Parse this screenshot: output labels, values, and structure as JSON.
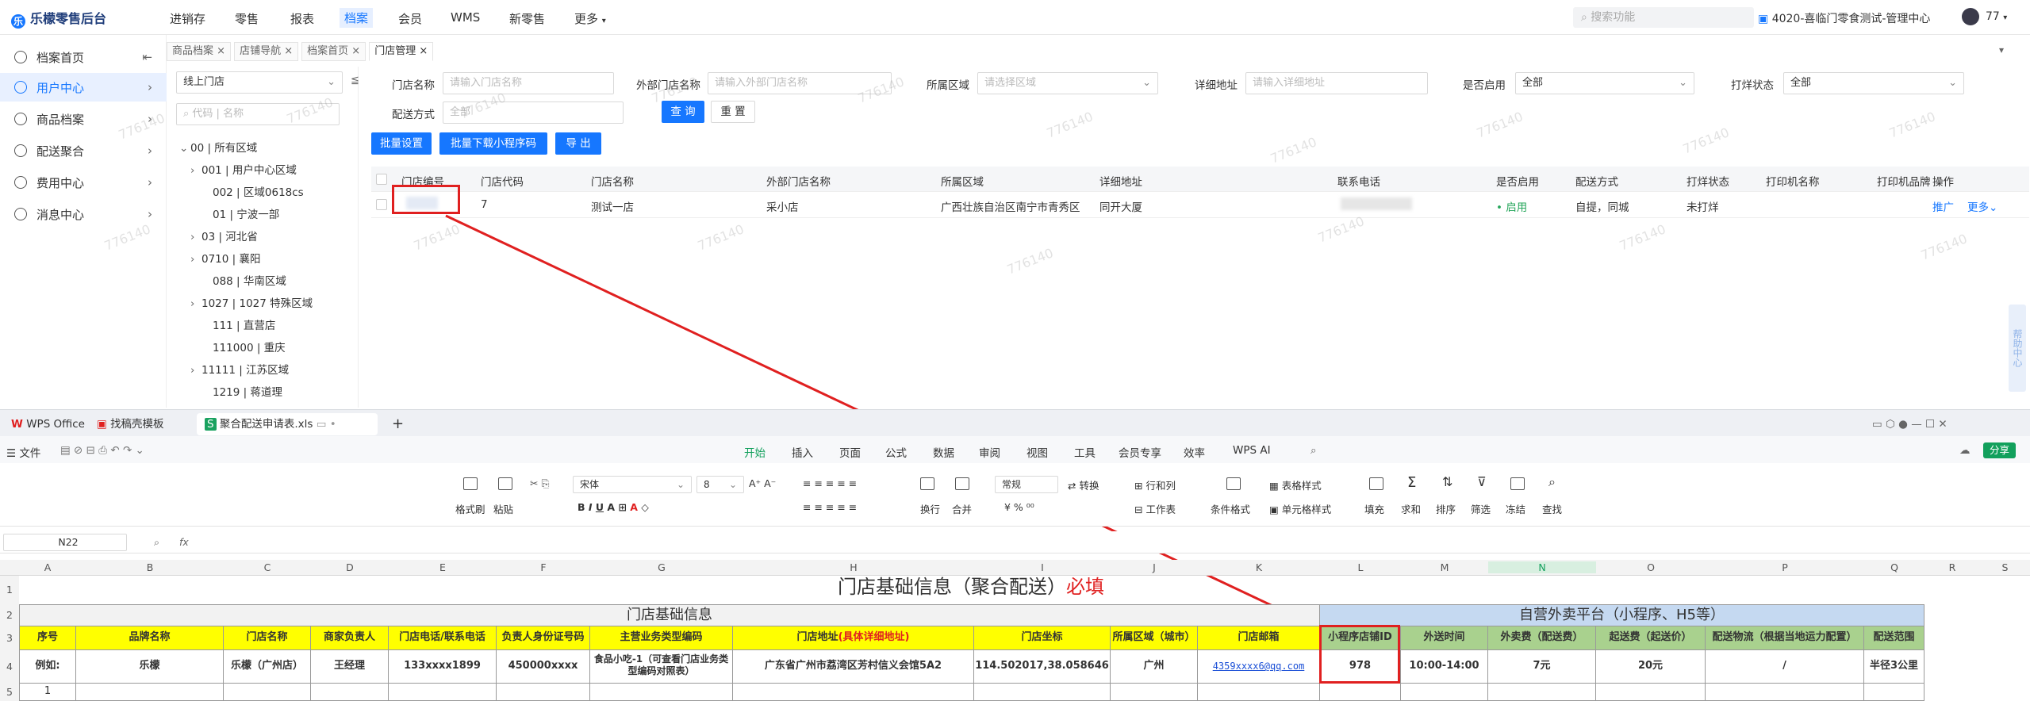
{
  "app": {
    "brand": "乐檬零售后台",
    "nav": [
      "进销存",
      "零售",
      "报表",
      "档案",
      "会员",
      "WMS",
      "新零售",
      "更多"
    ],
    "active_nav": "档案",
    "search_placeholder": "搜索功能",
    "store": "4020-喜临门零食测试-管理中心",
    "user": "77"
  },
  "sidebar": {
    "items": [
      {
        "label": "档案首页",
        "icon": "home-icon"
      },
      {
        "label": "用户中心",
        "icon": "user-icon"
      },
      {
        "label": "商品档案",
        "icon": "box-icon"
      },
      {
        "label": "配送聚合",
        "icon": "truck-icon"
      },
      {
        "label": "费用中心",
        "icon": "money-icon"
      },
      {
        "label": "消息中心",
        "icon": "bell-icon"
      }
    ],
    "active": "用户中心"
  },
  "tabs": [
    {
      "label": "商品档案"
    },
    {
      "label": "店铺导航"
    },
    {
      "label": "档案首页"
    },
    {
      "label": "门店管理"
    }
  ],
  "tree": {
    "store_type": "线上门店",
    "search_placeholder": "代码 | 名称",
    "nodes": [
      {
        "label": "00 | 所有区域",
        "expand": "open"
      },
      {
        "label": "001 | 用户中心区域",
        "expand": "closed"
      },
      {
        "label": "002 | 区域0618cs",
        "expand": "none"
      },
      {
        "label": "01 | 宁波一部",
        "expand": "none"
      },
      {
        "label": "03 | 河北省",
        "expand": "closed"
      },
      {
        "label": "0710 | 襄阳",
        "expand": "closed"
      },
      {
        "label": "088 | 华南区域",
        "expand": "none"
      },
      {
        "label": "1027 | 1027 特殊区域",
        "expand": "closed"
      },
      {
        "label": "111 | 直营店",
        "expand": "none"
      },
      {
        "label": "111000 | 重庆",
        "expand": "none"
      },
      {
        "label": "11111 | 江苏区域",
        "expand": "closed"
      },
      {
        "label": "1219 | 蒋道理",
        "expand": "none"
      }
    ]
  },
  "filters": {
    "store_name": {
      "label": "门店名称",
      "placeholder": "请输入门店名称"
    },
    "ext_name": {
      "label": "外部门店名称",
      "placeholder": "请输入外部门店名称"
    },
    "region": {
      "label": "所属区域",
      "placeholder": "请选择区域"
    },
    "address": {
      "label": "详细地址",
      "placeholder": "请输入详细地址"
    },
    "enabled": {
      "label": "是否启用",
      "value": "全部"
    },
    "print": {
      "label": "打烊状态",
      "value": "全部"
    },
    "delivery": {
      "label": "配送方式",
      "value": "全部"
    },
    "query": "查 询",
    "reset": "重 置"
  },
  "actions": {
    "batch_set": "批量设置",
    "batch_download": "批量下载小程序码",
    "export": "导 出"
  },
  "table": {
    "headers": [
      "门店编号",
      "门店代码",
      "门店名称",
      "外部门店名称",
      "所属区域",
      "详细地址",
      "联系电话",
      "是否启用",
      "配送方式",
      "打烊状态",
      "打印机名称",
      "打印机品牌",
      "操作"
    ],
    "row": {
      "code": "7",
      "name": "测试一店",
      "ext_name": "采小店",
      "region": "广西壮族自治区南宁市青秀区",
      "address": "同开大厦",
      "enabled": "启用",
      "delivery": "自提，同城",
      "print_status": "未打烊",
      "op1": "推广",
      "op2": "更多"
    }
  },
  "watermark": "776140",
  "help_tab": "帮助中心",
  "wps": {
    "tabs": [
      {
        "label": "WPS Office"
      },
      {
        "label": "找稿壳模板"
      },
      {
        "label": "聚合配送申请表.xls"
      }
    ],
    "file_menu": "文件",
    "menus": [
      "开始",
      "插入",
      "页面",
      "公式",
      "数据",
      "审阅",
      "视图",
      "工具",
      "会员专享",
      "效率",
      "WPS AI"
    ],
    "active_menu": "开始",
    "share": "分享",
    "ribbon": {
      "format_painter": "格式刷",
      "paste": "粘贴",
      "font": "宋体",
      "size": "8",
      "wrap": "换行",
      "merge": "合并",
      "general": "常规",
      "convert": "转换",
      "rowcol": "行和列",
      "sheet": "工作表",
      "cond": "条件格式",
      "tablestyle": "表格样式",
      "cellstyle": "单元格样式",
      "fill": "填充",
      "sum": "求和",
      "sort": "排序",
      "filter": "筛选",
      "freeze": "冻结",
      "find": "查找"
    },
    "cell_ref": "N22",
    "fx": "fx",
    "columns": [
      "A",
      "B",
      "C",
      "D",
      "E",
      "F",
      "G",
      "H",
      "I",
      "J",
      "K",
      "L",
      "M",
      "N",
      "O",
      "P",
      "Q",
      "R",
      "S"
    ],
    "rows": [
      "1",
      "2",
      "3",
      "4",
      "5"
    ]
  },
  "sheet": {
    "title_main": "门店基础信息（聚合配送）",
    "title_required": "必填",
    "section_left": "门店基础信息",
    "section_right": "自营外卖平台（小程序、H5等）",
    "headers": [
      "序号",
      "品牌名称",
      "门店名称",
      "商家负责人",
      "门店电话/联系电话",
      "负责人身份证号码",
      "主营业务类型编码",
      "门店地址",
      "门店坐标",
      "所属区域（城市）",
      "门店邮箱",
      "小程序店铺ID",
      "外送时间",
      "外卖费（配送费）",
      "起送费（起送价）",
      "配送物流（根据当地运力配置）",
      "配送范围"
    ],
    "address_note": "(具体详细地址)",
    "example": [
      "例如:",
      "乐檬",
      "乐檬（广州店）",
      "王经理",
      "133xxxx1899",
      "450000xxxx",
      "食品小吃-1（可查看门店业务类型编码对照表）",
      "广东省广州市荔湾区芳村信义会馆5A2",
      "114.502017,38.058646",
      "广州",
      "4359xxxx6@qq.com",
      "978",
      "10:00-14:00",
      "7元",
      "20元",
      "/",
      "半径3公里"
    ],
    "row5_index": "1"
  },
  "colors": {
    "accent": "#1677ff",
    "highlight_red": "#e02020",
    "sheet_yellow": "#ffff00",
    "sheet_green": "#a9d18e",
    "sheet_blue": "#c5d9f1"
  }
}
